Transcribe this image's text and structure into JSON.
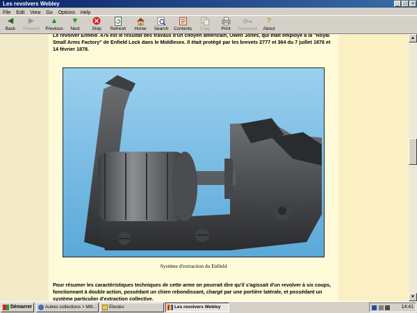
{
  "window": {
    "title": "Les revolvers Webley"
  },
  "menu": [
    "File",
    "Edit",
    "View",
    "Go",
    "Options",
    "Help"
  ],
  "toolbar": [
    {
      "label": "Back",
      "icon": "back-arrow-icon",
      "enabled": true
    },
    {
      "label": "Forward",
      "icon": "forward-arrow-icon",
      "enabled": false
    },
    {
      "label": "Previous",
      "icon": "previous-up-arrow-icon",
      "enabled": true
    },
    {
      "label": "Next",
      "icon": "next-down-arrow-icon",
      "enabled": true
    },
    {
      "label": "Stop",
      "icon": "stop-icon",
      "enabled": true
    },
    {
      "label": "Refresh",
      "icon": "refresh-icon",
      "enabled": true
    },
    {
      "label": "Home",
      "icon": "home-icon",
      "enabled": true
    },
    {
      "label": "Search",
      "icon": "search-icon",
      "enabled": true
    },
    {
      "label": "Contents",
      "icon": "contents-icon",
      "enabled": true
    },
    {
      "label": "Copy",
      "icon": "copy-icon",
      "enabled": false
    },
    {
      "label": "Print",
      "icon": "print-icon",
      "enabled": true
    },
    {
      "label": "Password",
      "icon": "password-key-icon",
      "enabled": false
    },
    {
      "label": "About",
      "icon": "about-icon",
      "enabled": true
    }
  ],
  "content": {
    "intro": "Le revolver Enfield .476 est le résultat des travaux d'un citoyen américain, Owen Jones, qui était employé à la \"Royal Small Arms Factory\" de Enfield Lock dans le Middlesex. Il était protégé par les brevets 2777 et 364 du 7 juillet 1876 et 14 février 1878.",
    "caption": "Système d'extraction du Enfield",
    "summary": "Pour résumer les caractéristiques techniques de cette arme on pourrait dire qu'il s'agissait d'un revolver à six coups, fonctionnant à double action, possédant un chien rebondissant, chargé par une portière latérale, et possédant un système particulier d'extraction collective."
  },
  "taskbar": {
    "start_label": "Démarrer",
    "tasks": [
      {
        "label": "Autres collections > Milt...",
        "active": false
      },
      {
        "label": "Ebooks",
        "active": false
      },
      {
        "label": "Les revolvers Webley",
        "active": true
      }
    ],
    "clock": "14:41"
  },
  "colors": {
    "page_bg": "#fffbd8",
    "side_bg": "#fbefc4",
    "photo_bg": "#7bbfe4",
    "titlebar": "#0a246a"
  }
}
